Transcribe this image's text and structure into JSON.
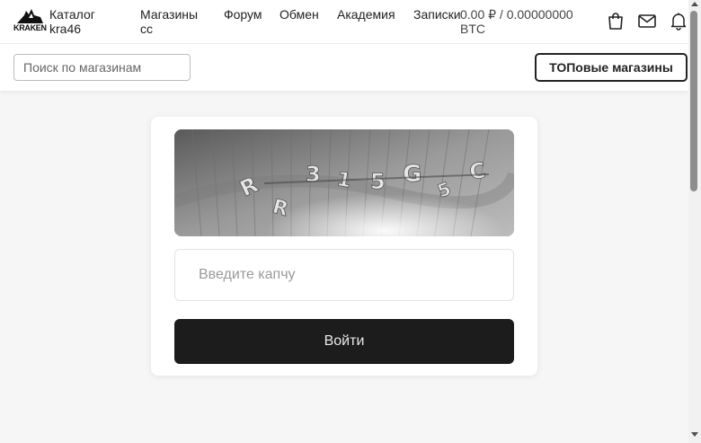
{
  "header": {
    "logo_text": "KRAKEN",
    "brand_title": "Каталог kra46",
    "nav": [
      {
        "label": "Магазины cc"
      },
      {
        "label": "Форум"
      },
      {
        "label": "Обмен"
      },
      {
        "label": "Академия"
      },
      {
        "label": "Записки"
      }
    ],
    "balance": "0.00 ₽ / 0.00000000 BTC",
    "icons": [
      "shopping-bag-icon",
      "mail-icon",
      "bell-icon"
    ]
  },
  "search": {
    "placeholder": "Поиск по магазинам",
    "top_button_label": "ТОПовые магазины"
  },
  "captcha": {
    "image_text": "R315G5C",
    "input_placeholder": "Введите капчу",
    "submit_label": "Войти"
  },
  "colors": {
    "accent": "#1c1c1c",
    "background": "#f6f6f6",
    "header": "#ffffff"
  }
}
